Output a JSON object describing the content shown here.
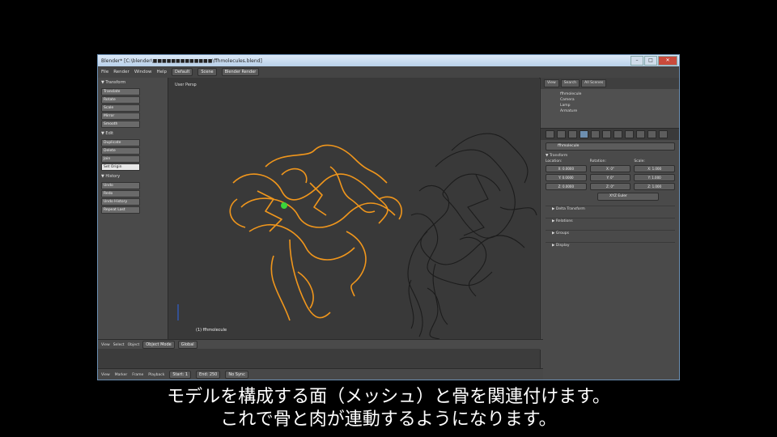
{
  "window": {
    "title": "Blender* [C:\\blender\\■■■■■■■■■■■■■\\ffhmolecules.blend]",
    "buttons": {
      "minimize": "–",
      "maximize": "□",
      "close": "✕"
    }
  },
  "menubar": {
    "items": [
      "File",
      "Render",
      "Window",
      "Help"
    ],
    "layout_field": "Default",
    "scene_field": "Scene",
    "engine_field": "Blender Render"
  },
  "toolshelf": {
    "transform_header": "▼ Transform",
    "transform_buttons": [
      "Translate",
      "Rotate",
      "Scale",
      "Mirror",
      "Smooth"
    ],
    "edit_header": "▼ Edit",
    "edit_buttons": [
      "Duplicate",
      "Delete",
      "Join",
      "Set Origin"
    ],
    "selected_button": "Set Origin",
    "history_header": "▼ History",
    "history_buttons": [
      "Undo",
      "Redo",
      "Undo History",
      "Repeat Last"
    ]
  },
  "viewport": {
    "label": "User Persp",
    "object_label": "(1) ffhmolecule"
  },
  "properties": {
    "tabs": [
      "View",
      "Search",
      "All Scenes"
    ],
    "outliner_rows": [
      "ffhmolecule",
      "Camera",
      "Lamp",
      "Armature"
    ],
    "object_name": "ffhmolecule",
    "transform_header": "▼ Transform",
    "column_labels": [
      "Location:",
      "Rotation:",
      "Scale:"
    ],
    "location": [
      "X: 0.0000",
      "Y: 0.0000",
      "Z: 0.0000"
    ],
    "rotation": [
      "X: 0°",
      "Y: 0°",
      "Z: 0°"
    ],
    "scale": [
      "X: 1.000",
      "Y: 1.000",
      "Z: 1.000"
    ],
    "rotation_mode": "XYZ Euler",
    "panels": [
      "▶ Delta Transform",
      "▶ Relations",
      "▶ Groups",
      "▶ Display"
    ]
  },
  "timeline_bar": {
    "items": [
      "View",
      "Select",
      "Object",
      "Object Mode",
      "Global"
    ]
  },
  "statusbar": {
    "items": [
      "View",
      "Marker",
      "Frame",
      "Playback",
      "Start: 1",
      "End: 250",
      "No Sync"
    ]
  },
  "subtitles": {
    "line1": "モデルを構成する面（メッシュ）と骨を関連付けます。",
    "line2": "これで骨と肉が連動するようになります。"
  },
  "colors": {
    "selected_mesh": "#f0961c",
    "unselected_mesh": "#1a1a1a",
    "bone_green": "#3ad43a"
  }
}
